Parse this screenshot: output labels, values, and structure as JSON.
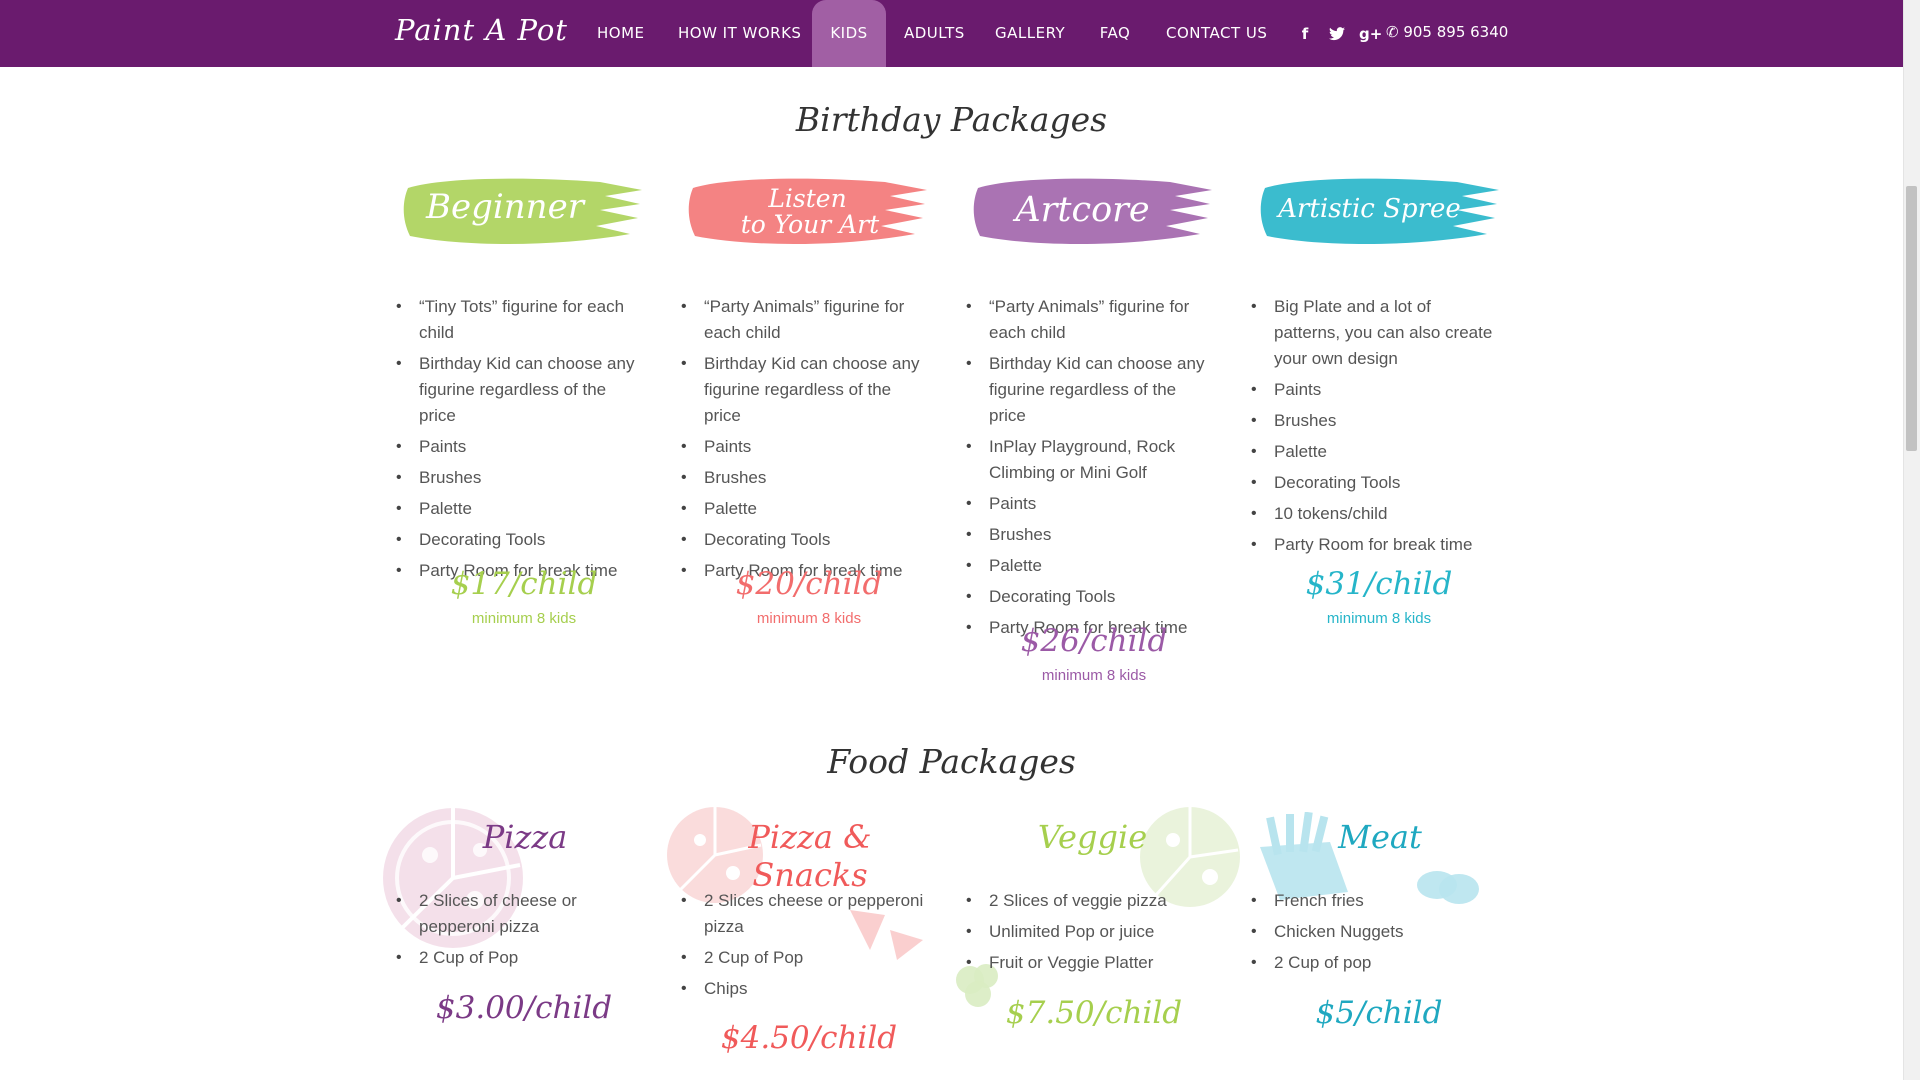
{
  "nav": {
    "brand": "Paint A Pot",
    "items": [
      "HOME",
      "HOW IT WORKS",
      "KIDS",
      "ADULTS",
      "GALLERY",
      "FAQ",
      "CONTACT US"
    ],
    "active": "KIDS",
    "social": {
      "facebook": "f",
      "twitter": "t",
      "googleplus": "g+"
    },
    "phone": "905 895 6340"
  },
  "birthday": {
    "title": "Birthday Packages",
    "packages": [
      {
        "name": "Beginner",
        "color": "#a6cf4e",
        "features": [
          "“Tiny Tots” figurine for each child",
          "Birthday Kid can choose any figurine regardless of the price",
          "Paints",
          "Brushes",
          "Palette",
          "Decorating Tools",
          "Party Room for break time"
        ],
        "price": "$17/child",
        "minimum": "minimum 8 kids"
      },
      {
        "name": "Listen to Your Art",
        "name_line1": "Listen",
        "name_line2": "to Your Art",
        "color": "#f26d6d",
        "features": [
          "“Party Animals” figurine for each child",
          "Birthday Kid can choose any figurine regardless of the price",
          "Paints",
          "Brushes",
          "Palette",
          "Decorating Tools",
          "Party Room for break time"
        ],
        "price": "$20/child",
        "minimum": "minimum 8 kids"
      },
      {
        "name": "Artcore",
        "color": "#9b5aa6",
        "features": [
          "“Party Animals” figurine for each child",
          "Birthday Kid can choose any figurine regardless of the price",
          "InPlay Playground, Rock Climbing or Mini Golf",
          "Paints",
          "Brushes",
          "Palette",
          "Decorating Tools",
          "Party Room for break time"
        ],
        "price": "$26/child",
        "minimum": "minimum 8 kids"
      },
      {
        "name": "Artistic Spree",
        "color": "#26b5c9",
        "features": [
          "Big Plate and a lot of patterns, you can also create your own design",
          "Paints",
          "Brushes",
          "Palette",
          "Decorating Tools",
          "10 tokens/child",
          "Party Room for break time"
        ],
        "price": "$31/child",
        "minimum": "minimum 8 kids"
      }
    ]
  },
  "food": {
    "title": "Food Packages",
    "packages": [
      {
        "name": "Pizza",
        "color": "#7b3a86",
        "features": [
          "2 Slices of cheese or pepperoni pizza",
          "2 Cup of Pop"
        ],
        "price": "$3.00/child"
      },
      {
        "name": "Pizza & Snacks",
        "color": "#f05a5a",
        "features": [
          "2 Slices cheese or pepperoni pizza",
          "2 Cup of Pop",
          "Chips"
        ],
        "price": "$4.50/child"
      },
      {
        "name": "Veggie",
        "color": "#a6cf4e",
        "features": [
          "2 Slices of veggie pizza",
          "Unlimited Pop or juice",
          "Fruit or Veggie Platter"
        ],
        "price": "$7.50/child"
      },
      {
        "name": "Meat",
        "color": "#1fa8c0",
        "features": [
          "French fries",
          "Chicken Nuggets",
          "2 Cup of pop"
        ],
        "price": "$5/child"
      }
    ]
  }
}
